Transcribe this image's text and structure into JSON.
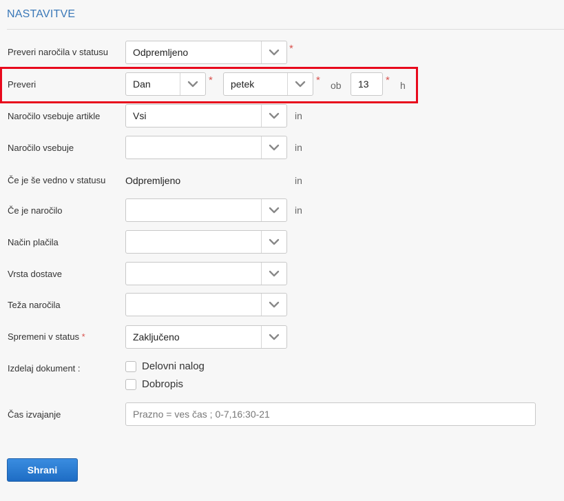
{
  "section": {
    "title": "NASTAVITVE"
  },
  "fields": {
    "preveri_status": {
      "label": "Preveri naročila v statusu",
      "value": "Odpremljeno",
      "required_mark": "*"
    },
    "preveri": {
      "label": "Preveri",
      "period_value": "Dan",
      "day_value": "petek",
      "at_label": "ob",
      "hour_value": "13",
      "hour_unit": "h",
      "required_mark": "*"
    },
    "vsebuje_artikle": {
      "label": "Naročilo vsebuje artikle",
      "value": "Vsi",
      "suffix": "in"
    },
    "vsebuje": {
      "label": "Naročilo vsebuje",
      "value": "",
      "suffix": "in"
    },
    "se_vedno_v_statusu": {
      "label": "Če je še vedno v statusu",
      "value": "Odpremljeno",
      "suffix": "in"
    },
    "ce_je_narocilo": {
      "label": "Če je naročilo",
      "value": "",
      "suffix": "in"
    },
    "nacin_placila": {
      "label": "Način plačila",
      "value": ""
    },
    "vrsta_dostave": {
      "label": "Vrsta dostave",
      "value": ""
    },
    "teza_narocila": {
      "label": "Teža naročila",
      "value": ""
    },
    "spremeni_v_status": {
      "label": "Spremeni v status",
      "required_mark": "*",
      "value": "Zaključeno"
    },
    "izdelaj_dokument": {
      "label": "Izdelaj dokument :",
      "options": [
        {
          "label": "Delovni nalog",
          "checked": false
        },
        {
          "label": "Dobropis",
          "checked": false
        }
      ]
    },
    "cas_izvajanje": {
      "label": "Čas izvajanje",
      "value": "",
      "placeholder": "Prazno = ves čas ; 0-7,16:30-21"
    }
  },
  "actions": {
    "save_label": "Shrani"
  },
  "colors": {
    "title": "#3a78b8",
    "required": "#d9534f",
    "highlight": "#e8091c",
    "primary_button": "#1e6cc4"
  },
  "icons": {
    "select_caret": "chevron-down-icon"
  }
}
